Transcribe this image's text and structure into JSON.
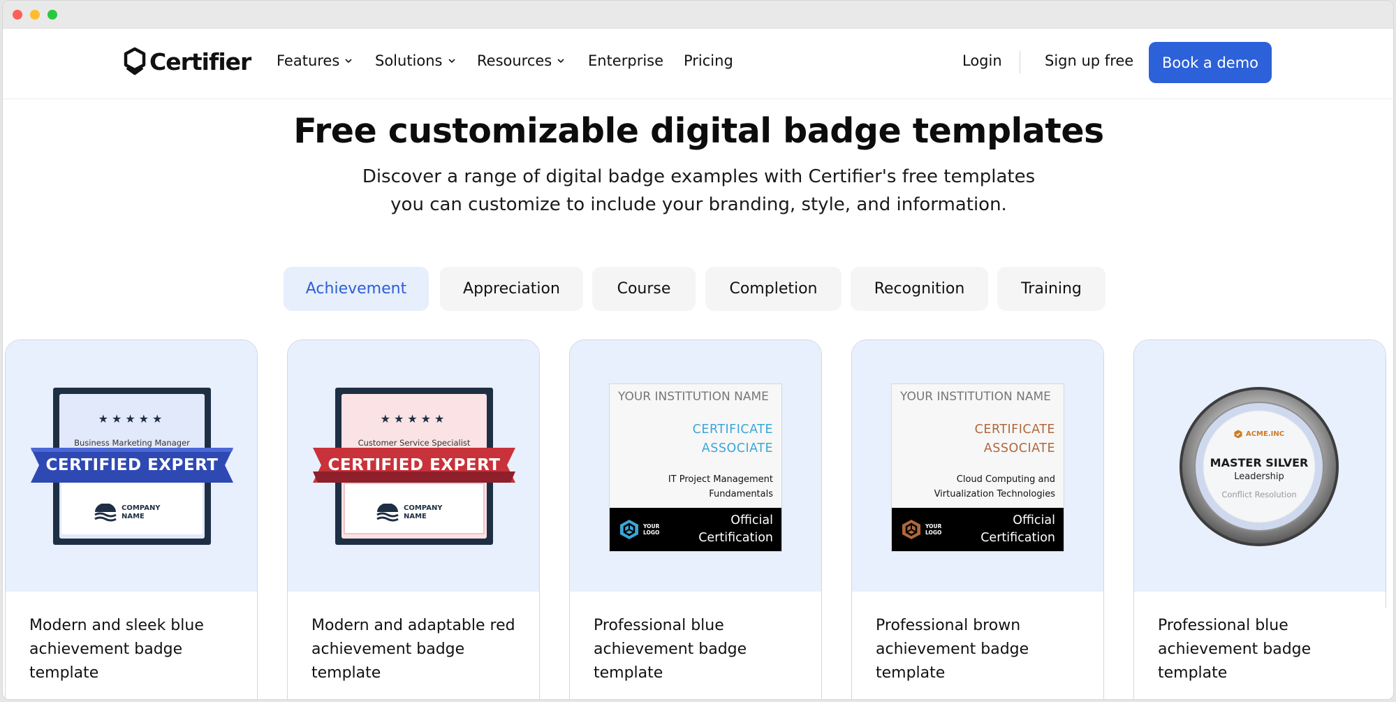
{
  "brand": {
    "name": "Certifier"
  },
  "nav": {
    "items": [
      {
        "label": "Features",
        "dropdown": true
      },
      {
        "label": "Solutions",
        "dropdown": true
      },
      {
        "label": "Resources",
        "dropdown": true
      },
      {
        "label": "Enterprise",
        "dropdown": false
      },
      {
        "label": "Pricing",
        "dropdown": false
      }
    ],
    "login": "Login",
    "signup": "Sign up free",
    "cta": "Book a demo"
  },
  "hero": {
    "title": "Free customizable digital badge templates",
    "subtitle_line1": "Discover a range of digital badge examples with Certifier's free templates",
    "subtitle_line2": "you can customize to include your branding, style, and information."
  },
  "tabs": [
    {
      "label": "Achievement",
      "active": true
    },
    {
      "label": "Appreciation",
      "active": false
    },
    {
      "label": "Course",
      "active": false
    },
    {
      "label": "Completion",
      "active": false
    },
    {
      "label": "Recognition",
      "active": false
    },
    {
      "label": "Training",
      "active": false
    }
  ],
  "cards": [
    {
      "title": "Modern and sleek blue achievement badge template",
      "badge": {
        "stars": "★★★★★",
        "role": "Business Marketing Manager",
        "ribbon": "CERTIFIED EXPERT",
        "company_line1": "COMPANY",
        "company_line2": "NAME",
        "ribbon_color": "#2f49b3"
      }
    },
    {
      "title": "Modern and adaptable red achievement badge template",
      "badge": {
        "stars": "★★★★★",
        "role": "Customer Service Specialist",
        "ribbon": "CERTIFIED EXPERT",
        "company_line1": "COMPANY",
        "company_line2": "NAME",
        "ribbon_color": "#c8323a"
      }
    },
    {
      "title": "Professional blue achievement badge template",
      "cert": {
        "institution": "YOUR INSTITUTION NAME",
        "name_line1": "CERTIFICATE",
        "name_line2": "ASSOCIATE",
        "course_line1": "IT Project Management",
        "course_line2": "Fundamentals",
        "logo_line1": "YOUR",
        "logo_line2": "LOGO",
        "official_line1": "Official",
        "official_line2": "Certification",
        "accent": "#3aa6d8"
      }
    },
    {
      "title": "Professional brown achievement badge template",
      "cert": {
        "institution": "YOUR INSTITUTION NAME",
        "name_line1": "CERTIFICATE",
        "name_line2": "ASSOCIATE",
        "course_line1": "Cloud Computing and",
        "course_line2": "Virtualization Technologies",
        "logo_line1": "YOUR",
        "logo_line2": "LOGO",
        "official_line1": "Official",
        "official_line2": "Certification",
        "accent": "#b0673a"
      }
    },
    {
      "title": "Professional blue achievement badge template",
      "medal": {
        "brand": "ACME.INC",
        "title": "MASTER SILVER",
        "subtitle": "Leadership",
        "subtitle2": "Conflict Resolution"
      }
    }
  ],
  "colors": {
    "primary": "#2c61d9",
    "tab_active_bg": "#e7eefc",
    "card_media_bg": "#e8effd"
  }
}
